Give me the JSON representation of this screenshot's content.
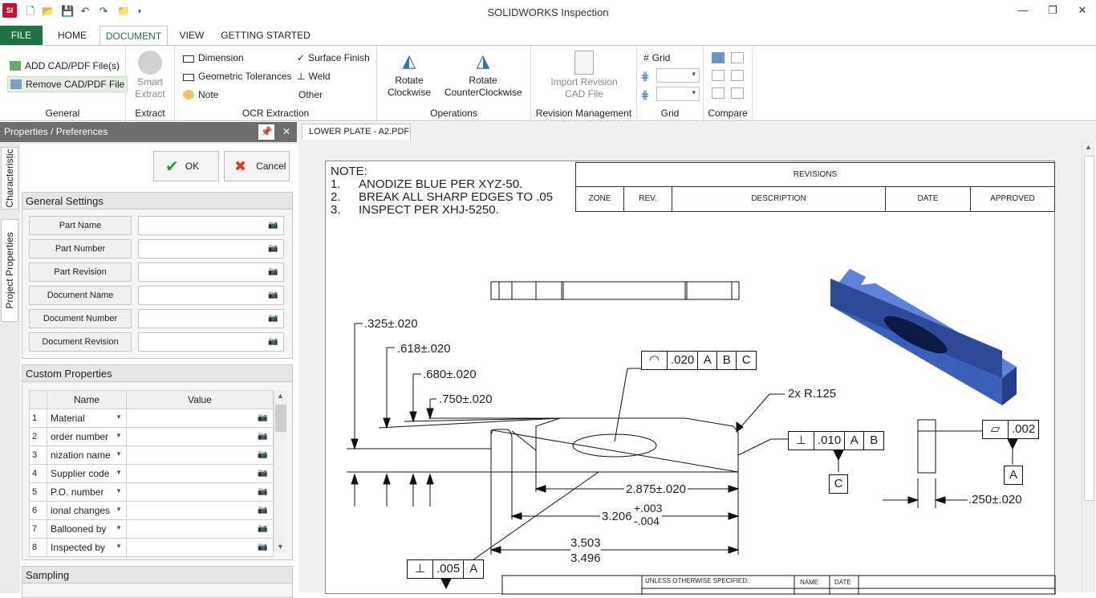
{
  "window": {
    "title": "SOLIDWORKS Inspection",
    "logo": "SI"
  },
  "quick_access": [
    "new-icon",
    "open-icon",
    "save-icon",
    "undo-icon",
    "redo-icon",
    "open-folder-icon",
    "customize-icon"
  ],
  "ribbon_tabs": [
    "FILE",
    "HOME",
    "DOCUMENT",
    "VIEW",
    "GETTING STARTED"
  ],
  "ribbon": {
    "general": {
      "label": "General",
      "add": "ADD CAD/PDF File(s)",
      "remove": "Remove CAD/PDF File"
    },
    "extract": {
      "label": "Extract",
      "smart": "Smart",
      "smart2": "Extract"
    },
    "ocr": {
      "label": "OCR Extraction",
      "dimension": "Dimension",
      "geometric": "Geometric Tolerances",
      "note": "Note",
      "surface": "Surface Finish",
      "weld": "Weld",
      "other": "Other"
    },
    "operations": {
      "label": "Operations",
      "rotate_cw1": "Rotate",
      "rotate_cw2": "Clockwise",
      "rotate_ccw1": "Rotate",
      "rotate_ccw2": "CounterClockwise"
    },
    "revision": {
      "label": "Revision Management",
      "import1": "Import Revision",
      "import2": "CAD File"
    },
    "grid": {
      "label": "Grid",
      "grid": "Grid"
    },
    "compare": {
      "label": "Compare"
    }
  },
  "panel": {
    "title": "Properties / Preferences",
    "vtabs": [
      "Characteristic",
      "Project Properties"
    ],
    "ok": "OK",
    "cancel": "Cancel",
    "general_settings": "General Settings",
    "fields": [
      "Part Name",
      "Part Number",
      "Part Revision",
      "Document Name",
      "Document Number",
      "Document Revision"
    ],
    "custom_properties": "Custom Properties",
    "col_name": "Name",
    "col_value": "Value",
    "rows": [
      {
        "n": "1",
        "name": "Material"
      },
      {
        "n": "2",
        "name": "order number"
      },
      {
        "n": "3",
        "name": "nization name"
      },
      {
        "n": "4",
        "name": "Supplier code"
      },
      {
        "n": "5",
        "name": "P.O. number"
      },
      {
        "n": "6",
        "name": "ional changes"
      },
      {
        "n": "7",
        "name": "Ballooned by"
      },
      {
        "n": "8",
        "name": "Inspected by"
      }
    ],
    "sampling": "Sampling"
  },
  "document_tab": "LOWER PLATE - A2.PDF",
  "drawing": {
    "note_title": "NOTE:",
    "notes": [
      {
        "n": "1.",
        "t": "ANODIZE BLUE PER XYZ-50."
      },
      {
        "n": "2.",
        "t": "BREAK ALL SHARP EDGES TO .05"
      },
      {
        "n": "3.",
        "t": "INSPECT PER XHJ-5250."
      }
    ],
    "revisions": "REVISIONS",
    "rev_cols": [
      "ZONE",
      "REV.",
      "DESCRIPTION",
      "DATE",
      "APPROVED"
    ],
    "dims": {
      "d1": ".325±.020",
      "d2": ".618±.020",
      "d3": ".680±.020",
      "d4": ".750±.020",
      "d5": "2.875±.020",
      "d6": "3.206",
      "d6a": "+.003",
      "d6b": "-.004",
      "d7": "3.503",
      "d8": "3.496",
      "r": "2x R.125",
      "t1": ".250±.020"
    },
    "fcf1": {
      "tol": ".020",
      "a": "A",
      "b": "B",
      "c": "C"
    },
    "fcf2": {
      "tol": ".010",
      "a": "A",
      "b": "B"
    },
    "fcf3": {
      "tol": ".002"
    },
    "fcf4": {
      "tol": ".005",
      "a": "A"
    },
    "datum_c": "C",
    "datum_a": "A",
    "title_block": {
      "unless": "UNLESS OTHERWISE SPECIFIED:",
      "name": "NAME",
      "date": "DATE"
    }
  }
}
